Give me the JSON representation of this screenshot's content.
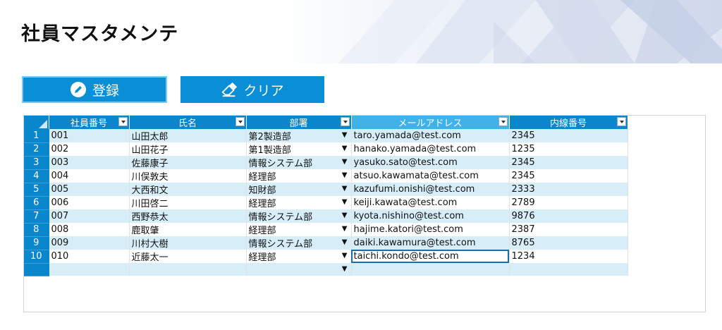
{
  "header": {
    "title": "社員マスタメンテ"
  },
  "toolbar": {
    "register_label": "登録",
    "clear_label": "クリア"
  },
  "table": {
    "columns": [
      "社員番号",
      "氏名",
      "部署",
      "メールアドレス",
      "内線番号"
    ],
    "rows": [
      {
        "num": "1",
        "id": "001",
        "name": "山田太郎",
        "dept": "第2製造部",
        "email": "taro.yamada@test.com",
        "ext": "2345"
      },
      {
        "num": "2",
        "id": "002",
        "name": "山田花子",
        "dept": "第1製造部",
        "email": "hanako.yamada@test.com",
        "ext": "1235"
      },
      {
        "num": "3",
        "id": "003",
        "name": "佐藤康子",
        "dept": "情報システム部",
        "email": "yasuko.sato@test.com",
        "ext": "2345"
      },
      {
        "num": "4",
        "id": "004",
        "name": "川俣敦夫",
        "dept": "経理部",
        "email": "atsuo.kawamata@test.com",
        "ext": "2345"
      },
      {
        "num": "5",
        "id": "005",
        "name": "大西和文",
        "dept": "知財部",
        "email": "kazufumi.onishi@test.com",
        "ext": "2333"
      },
      {
        "num": "6",
        "id": "006",
        "name": "川田啓二",
        "dept": "経理部",
        "email": "keiji.kawata@test.com",
        "ext": "2789"
      },
      {
        "num": "7",
        "id": "007",
        "name": "西野恭太",
        "dept": "情報システム部",
        "email": "kyota.nishino@test.com",
        "ext": "9876"
      },
      {
        "num": "8",
        "id": "008",
        "name": "鹿取肇",
        "dept": "経理部",
        "email": "hajime.katori@test.com",
        "ext": "2387"
      },
      {
        "num": "9",
        "id": "009",
        "name": "川村大樹",
        "dept": "情報システム部",
        "email": "daiki.kawamura@test.com",
        "ext": "8765"
      },
      {
        "num": "10",
        "id": "010",
        "name": "近藤太一",
        "dept": "経理部",
        "email": "taichi.kondo@test.com",
        "ext": "1234"
      }
    ],
    "dropdown_arrow": "▼"
  }
}
